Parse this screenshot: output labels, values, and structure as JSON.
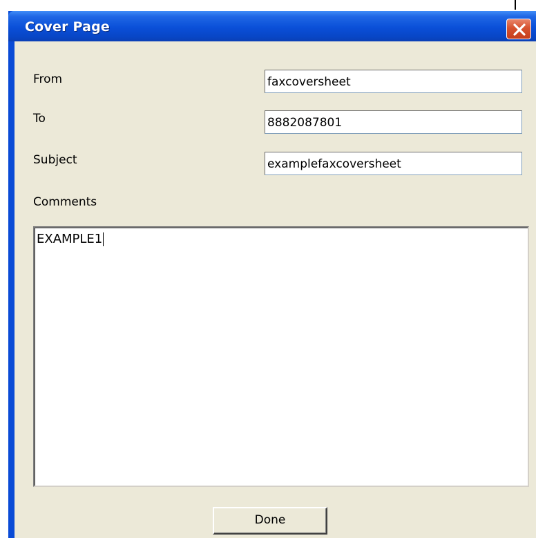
{
  "window": {
    "title": "Cover Page",
    "close_icon": "close-icon"
  },
  "form": {
    "from_label": "From",
    "from_value": "faxcoversheet",
    "to_label": "To",
    "to_value": "8882087801",
    "subject_label": "Subject",
    "subject_value": "examplefaxcoversheet",
    "comments_label": "Comments",
    "comments_value": "EXAMPLE1"
  },
  "actions": {
    "done_label": "Done"
  },
  "colors": {
    "titlebar": "#0a4fd8",
    "client_bg": "#ece9d8",
    "close_button": "#d6522f"
  }
}
